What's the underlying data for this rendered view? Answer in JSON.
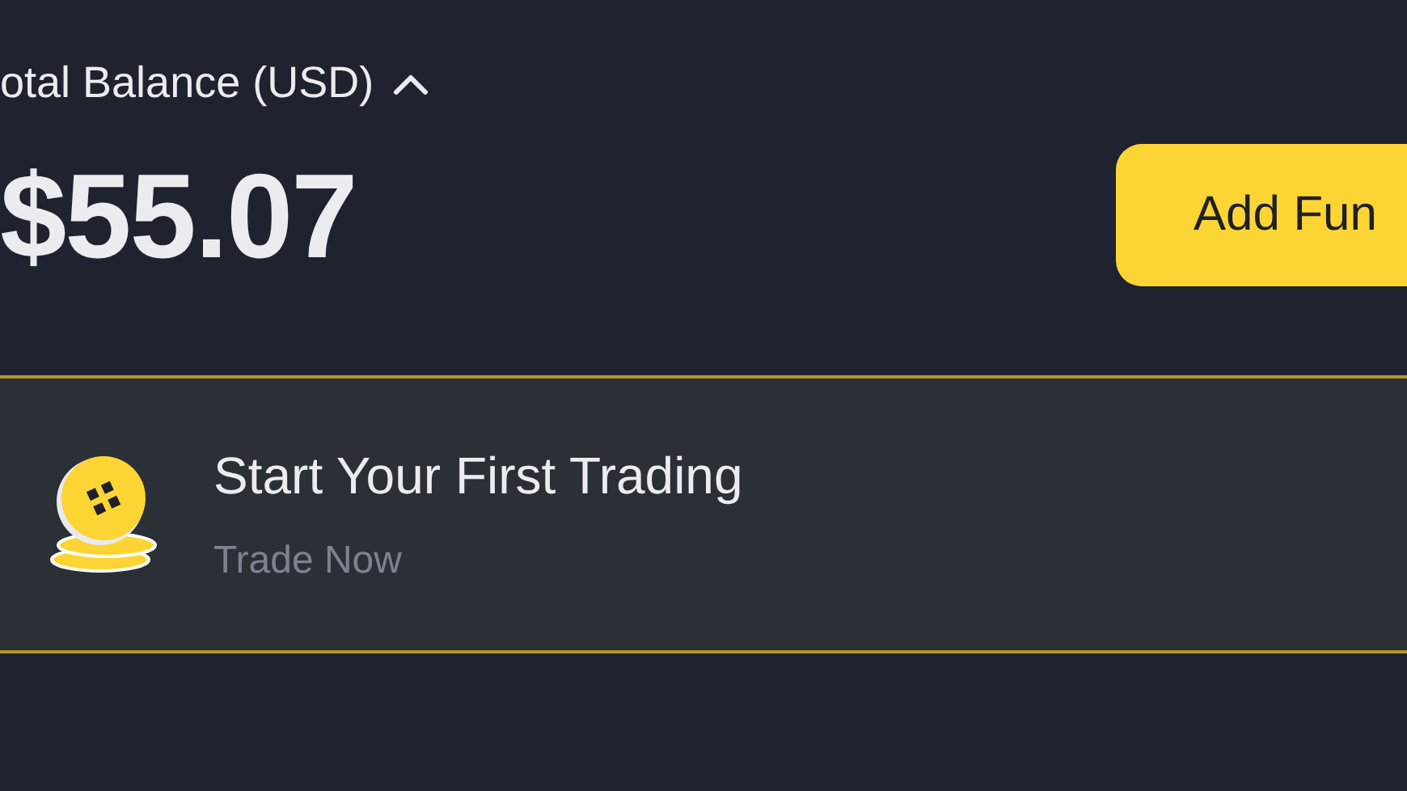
{
  "balance": {
    "label": "otal Balance (USD)",
    "expanded": true,
    "amount": "$55.07"
  },
  "add_funds_button": {
    "label": "Add Fun"
  },
  "promo_card": {
    "title": "Start Your First Trading",
    "action": "Trade Now"
  }
}
